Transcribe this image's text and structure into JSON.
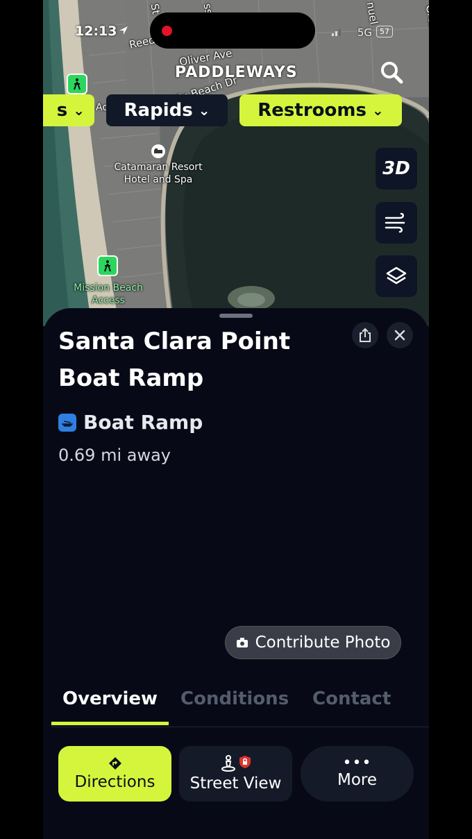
{
  "status_bar": {
    "time": "12:13",
    "network": "5G",
    "battery": "57"
  },
  "app": {
    "brand": "PADDLEWAYS"
  },
  "map": {
    "streets": [
      "Reed",
      "Oliver Ave",
      "cific Beach Dr",
      "Grest",
      "nuel",
      "ss",
      "St"
    ],
    "places": [
      {
        "label_line1": "Catamaran Resort",
        "label_line2": "Hotel and Spa"
      },
      {
        "label_line1": "Mission Beach",
        "label_line2": "Access"
      }
    ],
    "partial_label": "Ac"
  },
  "filters": {
    "chips": [
      {
        "label": "s"
      },
      {
        "label": "Rapids"
      },
      {
        "label": "Restrooms"
      }
    ]
  },
  "map_controls": {
    "three_d_label": "3D"
  },
  "place": {
    "title": "Santa Clara Point Boat Ramp",
    "category": "Boat Ramp",
    "distance": "0.69 mi away",
    "contribute_label": "Contribute Photo"
  },
  "tabs": [
    {
      "label": "Overview"
    },
    {
      "label": "Conditions"
    },
    {
      "label": "Contact"
    }
  ],
  "actions": {
    "directions": "Directions",
    "street_view": "Street View",
    "more": "More"
  },
  "colors": {
    "accent": "#d4f53c",
    "sheet_bg": "#070a16",
    "poi_green": "#2bd65c",
    "record_red": "#e0142a"
  }
}
